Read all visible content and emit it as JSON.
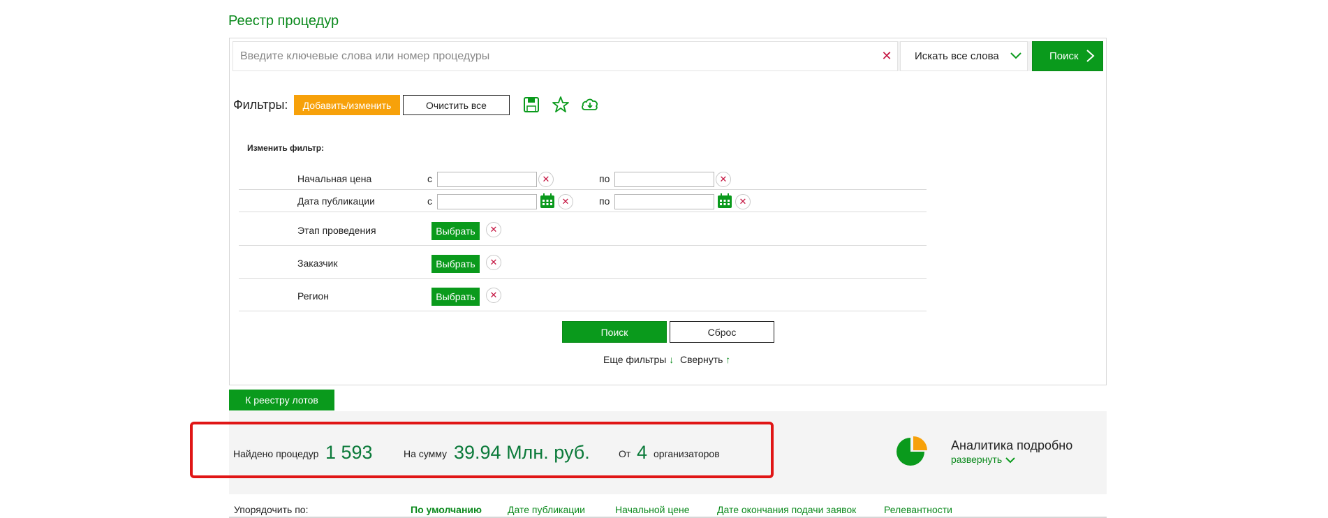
{
  "page": {
    "title": "Реестр процедур"
  },
  "search": {
    "placeholder": "Введите ключевые слова или номер процедуры",
    "value": "",
    "mode": "Искать все слова",
    "button": "Поиск",
    "clear_icon": "close-icon"
  },
  "filters": {
    "label": "Фильтры:",
    "add_button": "Добавить/изменить",
    "clear_button": "Очистить все",
    "icons": [
      "save-icon",
      "star-icon",
      "cloud-download-icon"
    ],
    "edit_label": "Изменить фильтр:",
    "rows": {
      "price": {
        "label": "Начальная цена",
        "from": "с",
        "to": "по",
        "from_value": "",
        "to_value": ""
      },
      "date": {
        "label": "Дата публикации",
        "from": "с",
        "to": "по",
        "from_value": "",
        "to_value": ""
      },
      "stage": {
        "label": "Этап проведения",
        "button": "Выбрать"
      },
      "customer": {
        "label": "Заказчик",
        "button": "Выбрать"
      },
      "region": {
        "label": "Регион",
        "button": "Выбрать"
      }
    },
    "search_button": "Поиск",
    "reset_button": "Сброс",
    "more_filters": "Еще фильтры",
    "collapse": "Свернуть"
  },
  "lots_button": "К реестру лотов",
  "summary": {
    "found_label": "Найдено процедур",
    "found_value": "1 593",
    "sum_label": "На сумму",
    "sum_value": "39.94 Млн. руб.",
    "from_label": "От",
    "org_count": "4",
    "org_label": "организаторов"
  },
  "analytics": {
    "title": "Аналитика подробно",
    "expand": "развернуть",
    "icon": "pie-chart-icon"
  },
  "sort": {
    "label": "Упорядочить по:",
    "options": [
      "По умолчанию",
      "Дате публикации",
      "Начальной цене",
      "Дате окончания подачи заявок",
      "Релевантности"
    ],
    "active": "По умолчанию"
  },
  "colors": {
    "accent_green": "#0a9a1c",
    "orange": "#f7a10a",
    "highlight_red": "#e01616",
    "clear_red": "#c4123f"
  }
}
